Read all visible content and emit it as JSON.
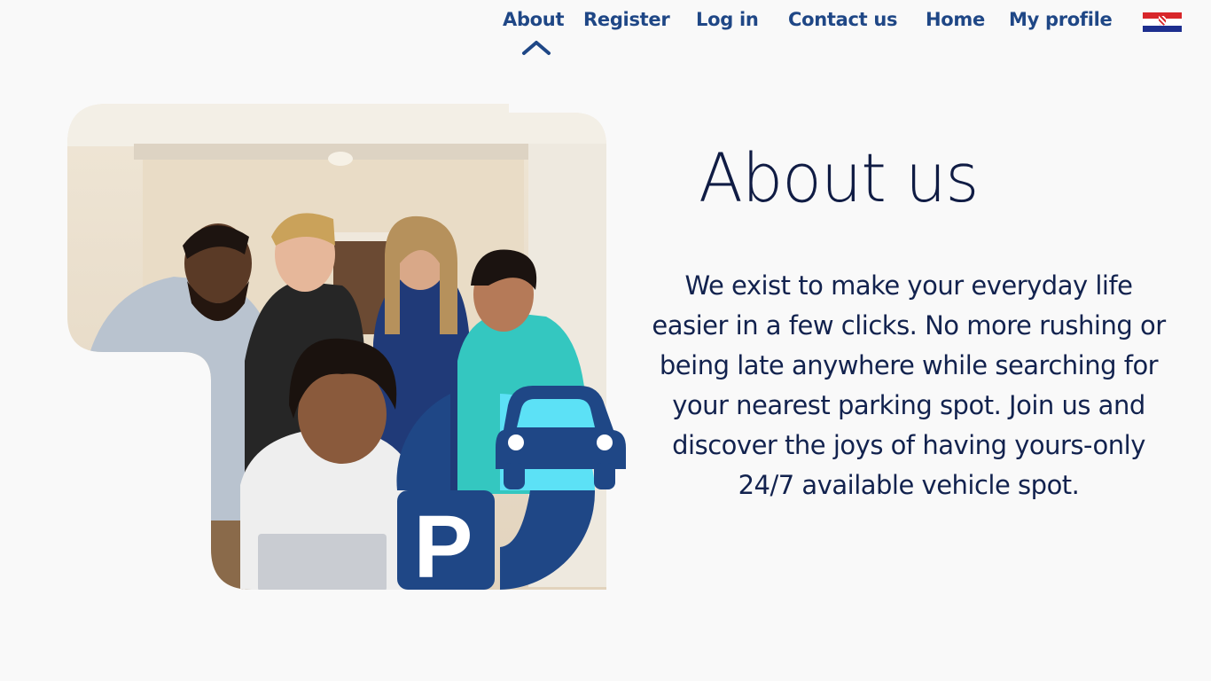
{
  "nav": {
    "items": [
      {
        "label": "About"
      },
      {
        "label": "Register"
      },
      {
        "label": "Log in"
      },
      {
        "label": "Contact us"
      },
      {
        "label": "Home"
      },
      {
        "label": "My  profile"
      }
    ],
    "active": "About",
    "language_flag": "croatia-flag-icon"
  },
  "main": {
    "title": "About us",
    "text": "We exist  to make your everyday life\neasier in a few clicks. No more rushing or\nbeing late anywhere while searching for\nyour nearest parking spot. Join us and\ndiscover the joys of having yours-only\n24/7 available vehicle spot.",
    "logo_letter": "P"
  },
  "colors": {
    "background": "#f9f9f9",
    "nav_text": "#1f4786",
    "title_text": "#101c44",
    "logo_blue": "#1f4786",
    "logo_cyan": "#5ce1f6"
  }
}
